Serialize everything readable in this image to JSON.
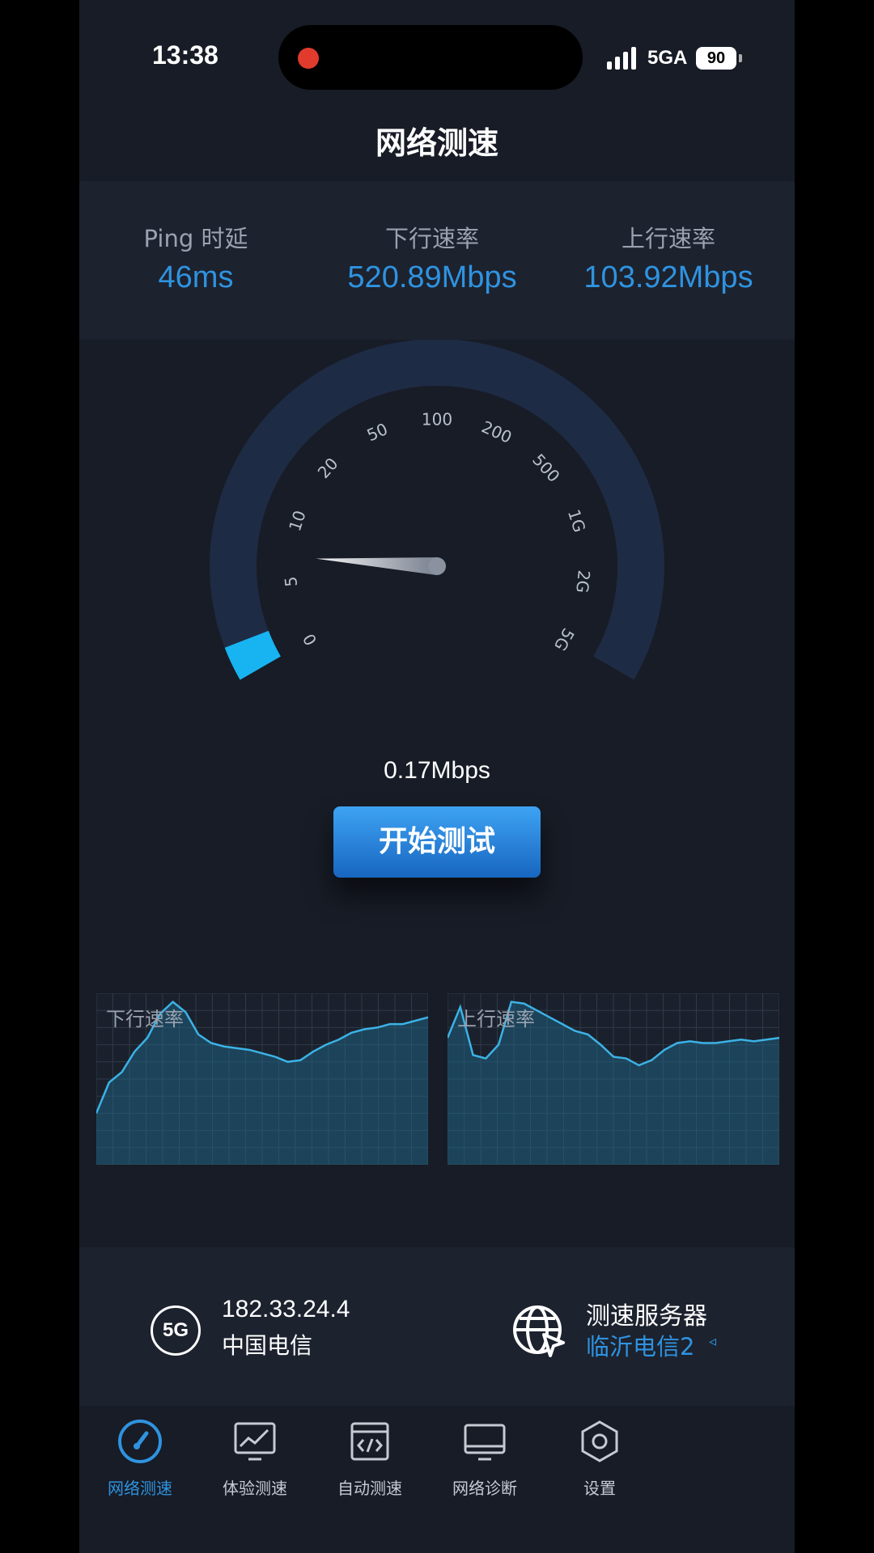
{
  "status_bar": {
    "time": "13:38",
    "network": "5GA",
    "battery": "90"
  },
  "header": {
    "title": "网络测速"
  },
  "stats": {
    "ping_label": "Ping 时延",
    "ping_value": "46ms",
    "download_label": "下行速率",
    "download_value": "520.89Mbps",
    "upload_label": "上行速率",
    "upload_value": "103.92Mbps"
  },
  "gauge": {
    "ticks": [
      "0",
      "5",
      "10",
      "20",
      "50",
      "100",
      "200",
      "500",
      "1G",
      "2G",
      "5G"
    ],
    "needle_fraction": 0.0,
    "current_speed": "0.17Mbps",
    "colors": {
      "track": "#1e2b44",
      "progress": "#18b4f2"
    }
  },
  "start_button": {
    "label": "开始测试"
  },
  "charts": {
    "download": {
      "title": "下行速率",
      "values": [
        30,
        48,
        54,
        66,
        74,
        88,
        95,
        89,
        76,
        71,
        69,
        68,
        67,
        65,
        63,
        60,
        61,
        66,
        70,
        73,
        77,
        79,
        80,
        82,
        82,
        84,
        86
      ]
    },
    "upload": {
      "title": "上行速率",
      "values": [
        74,
        92,
        64,
        62,
        70,
        95,
        94,
        90,
        86,
        82,
        78,
        76,
        70,
        63,
        62,
        58,
        61,
        67,
        71,
        72,
        71,
        71,
        72,
        73,
        72,
        73,
        74
      ]
    }
  },
  "server_info": {
    "network_badge": "5G",
    "ip": "182.33.24.4",
    "carrier": "中国电信",
    "server_label": "测速服务器",
    "server_name": "临沂电信2",
    "server_caret": "◃"
  },
  "tabs": [
    {
      "label": "网络测速",
      "icon": "speedometer-icon",
      "active": true
    },
    {
      "label": "体验测速",
      "icon": "trend-monitor-icon",
      "active": false
    },
    {
      "label": "自动测速",
      "icon": "code-window-icon",
      "active": false
    },
    {
      "label": "网络诊断",
      "icon": "monitor-icon",
      "active": false
    },
    {
      "label": "设置",
      "icon": "hexagon-settings-icon",
      "active": false
    }
  ]
}
